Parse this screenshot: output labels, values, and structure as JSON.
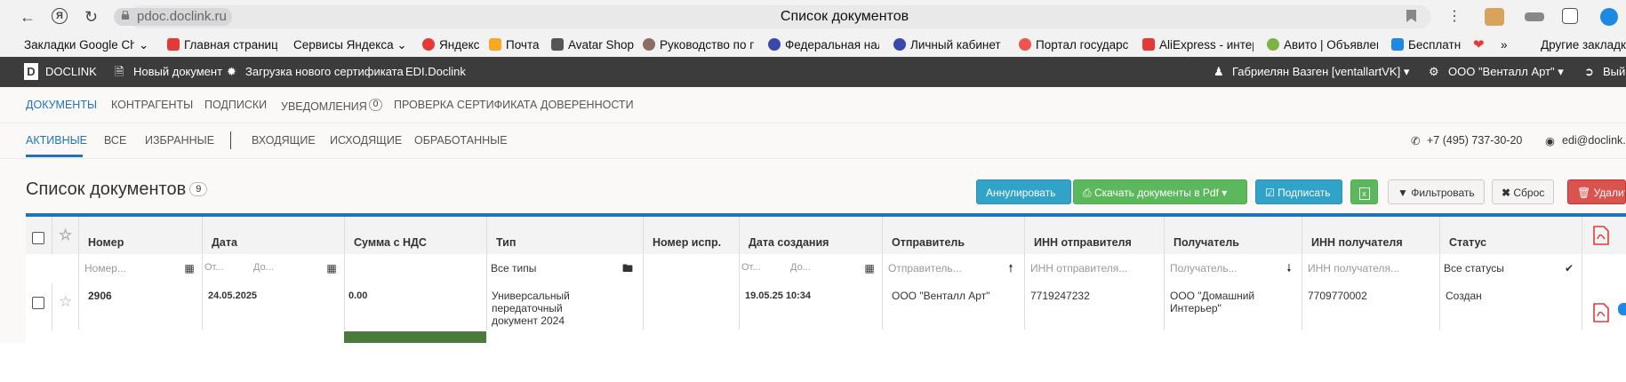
{
  "browser": {
    "url": "pdoc.doclink.ru",
    "title": "Список документов",
    "icons": [
      "back-arrow-icon",
      "yandex-icon",
      "reload-icon",
      "lock-icon",
      "bookmark-icon",
      "more-icon"
    ]
  },
  "bookmarks": [
    {
      "label": "Закладки Google Ch",
      "icon": "folder-icon",
      "color": "#ffffff"
    },
    {
      "label": "Главная страница",
      "icon": "yandex-icon",
      "color": "#e53935"
    },
    {
      "label": "Сервисы Яндекса",
      "icon": "folder-icon",
      "color": "#ffffff"
    },
    {
      "label": "Яндекс",
      "icon": "yandex-icon",
      "color": "#e53935"
    },
    {
      "label": "Почта",
      "icon": "mail-icon",
      "color": "#f9a825"
    },
    {
      "label": "Avatar Shop",
      "icon": "shop-icon",
      "color": "#555555"
    },
    {
      "label": "Руководство по п",
      "icon": "gear-icon",
      "color": "#8d6e63"
    },
    {
      "label": "Федеральная нал",
      "icon": "emblem-icon",
      "color": "#3949ab"
    },
    {
      "label": "Личный кабинет",
      "icon": "emblem-icon",
      "color": "#3949ab"
    },
    {
      "label": "Портал государс",
      "icon": "gov-icon",
      "color": "#ef5350"
    },
    {
      "label": "AliExpress - интер",
      "icon": "ali-icon",
      "color": "#e53935"
    },
    {
      "label": "Авито | Объявлен",
      "icon": "avito-icon",
      "color": "#7cb342"
    },
    {
      "label": "Бесплатн",
      "icon": "gift-icon",
      "color": "#1e88e5"
    },
    {
      "label": "",
      "icon": "heart-icon",
      "color": "#e53935"
    },
    {
      "label": "»",
      "icon": "",
      "color": ""
    },
    {
      "label": "Другие закладки",
      "icon": "",
      "color": ""
    }
  ],
  "appbar": {
    "logo": "DOCLINK",
    "logo_letter": "D",
    "new_doc": "Новый документ",
    "upload_cert": "Загрузка нового сертификата",
    "edi": "EDI.Doclink",
    "user": "Габриелян Вазген [ventallartVK]",
    "org": "ООО \"Венталл Арт\"",
    "logout": "Вый"
  },
  "tabs_main": [
    {
      "label": "ДОКУМЕНТЫ",
      "active": true
    },
    {
      "label": "КОНТРАГЕНТЫ",
      "active": false
    },
    {
      "label": "ПОДПИСКИ",
      "active": false
    },
    {
      "label": "УВЕДОМЛЕНИЯ",
      "active": false,
      "badge": "0"
    },
    {
      "label": "ПРОВЕРКА СЕРТИФИКАТА",
      "active": false
    },
    {
      "label": "ДОВЕРЕННОСТИ",
      "active": false
    }
  ],
  "tabs_sub": [
    {
      "label": "АКТИВНЫЕ",
      "active": true
    },
    {
      "label": "ВСЕ",
      "active": false
    },
    {
      "label": "ИЗБРАННЫЕ",
      "active": false
    },
    {
      "label": "ВХОДЯЩИЕ",
      "active": false
    },
    {
      "label": "ИСХОДЯЩИЕ",
      "active": false
    },
    {
      "label": "ОБРАБОТАННЫЕ",
      "active": false
    }
  ],
  "contacts": {
    "phone": "+7 (495) 737-30-20",
    "email": "edi@doclink."
  },
  "list": {
    "title": "Список документов",
    "count": "9"
  },
  "buttons": {
    "annul": "Аннулировать",
    "download_pdf": "Скачать документы в Pdf",
    "sign": "Подписать",
    "filter": "Фильтровать",
    "reset": "Сброс",
    "delete": "Удалит"
  },
  "table": {
    "headers": {
      "number": "Номер",
      "date": "Дата",
      "sum": "Сумма с НДС",
      "type": "Тип",
      "fix_number": "Номер испр.",
      "created": "Дата создания",
      "sender": "Отправитель",
      "sender_inn": "ИНН отправителя",
      "receiver": "Получатель",
      "receiver_inn": "ИНН получателя",
      "status": "Статус"
    },
    "filters": {
      "number": "Номер...",
      "date_from": "От...",
      "date_to": "До...",
      "type": "Все типы",
      "created_from": "От...",
      "created_to": "До...",
      "sender": "Отправитель...",
      "sender_inn": "ИНН отправителя...",
      "receiver": "Получатель...",
      "receiver_inn": "ИНН получателя...",
      "status": "Все статусы"
    },
    "rows": [
      {
        "number": "2906",
        "date": "24.05.2025",
        "sum": "0.00",
        "type": "Универсальный передаточный документ 2024",
        "fix_number": "",
        "created": "19.05.25 10:34",
        "sender": "ООО \"Венталл Арт\"",
        "sender_inn": "7719247232",
        "receiver": "ООО \"Домашний Интерьер\"",
        "receiver_inn": "7709770002",
        "status": "Создан"
      }
    ]
  },
  "colors": {
    "accent": "#1d74bd",
    "appbar": "#3c3c3c",
    "info": "#31a3c8",
    "success": "#5cb85c",
    "danger": "#d9534f",
    "pdf_red": "#e53935"
  }
}
